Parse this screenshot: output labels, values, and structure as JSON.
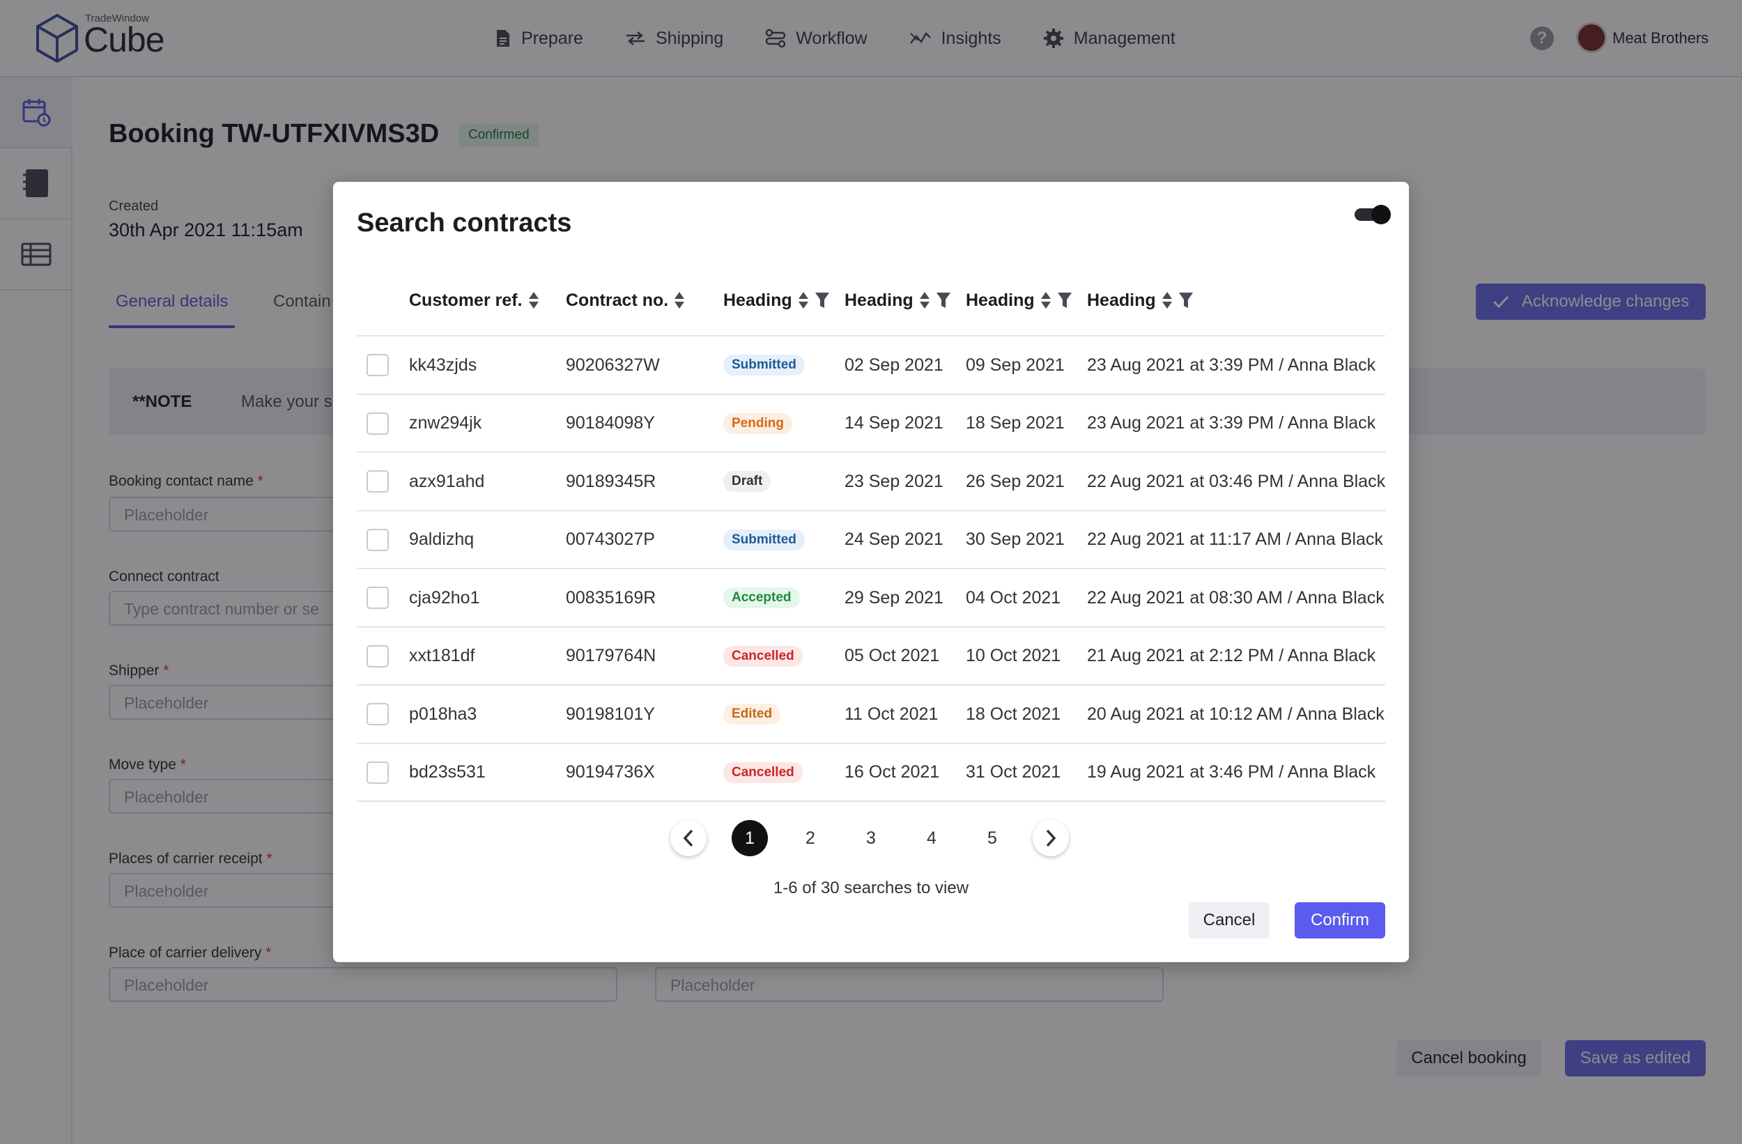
{
  "app": {
    "brand_small": "TradeWindow",
    "brand_name": "Cube",
    "nav": [
      {
        "label": "Prepare",
        "icon": "document-icon"
      },
      {
        "label": "Shipping",
        "icon": "swap-arrows-icon"
      },
      {
        "label": "Workflow",
        "icon": "workflow-icon"
      },
      {
        "label": "Insights",
        "icon": "trend-icon"
      },
      {
        "label": "Management",
        "icon": "gear-icon"
      }
    ],
    "account_name": "Meat Brothers"
  },
  "sidebar": {
    "items": [
      {
        "icon": "calendar-clock-icon",
        "active": true
      },
      {
        "icon": "notebook-icon",
        "active": false
      },
      {
        "icon": "table-list-icon",
        "active": false
      }
    ]
  },
  "page": {
    "title": "Booking TW-UTFXIVMS3D",
    "status": "Confirmed",
    "created_label": "Created",
    "created_value": "30th Apr 2021 11:15am",
    "tabs": [
      "General details",
      "Contain"
    ],
    "acknowledge_label": "Acknowledge changes",
    "note_label": "**NOTE",
    "note_text": "Make your select",
    "fields": {
      "booking_contact": {
        "label": "Booking contact name",
        "placeholder": "Placeholder"
      },
      "connect_contract": {
        "label": "Connect contract",
        "placeholder": "Type contract number or se"
      },
      "shipper": {
        "label": "Shipper",
        "placeholder": "Placeholder"
      },
      "move_type": {
        "label": "Move type",
        "placeholder": "Placeholder"
      },
      "carrier_receipt": {
        "label": "Places of carrier receipt",
        "placeholder": "Placeholder"
      },
      "carrier_delivery": {
        "label": "Place of carrier delivery",
        "placeholder": "Placeholder",
        "placeholder_right": "Placeholder"
      }
    },
    "required_mark": "*",
    "cancel_booking": "Cancel booking",
    "save_as_edited": "Save as edited"
  },
  "modal": {
    "title": "Search contracts",
    "columns": [
      "Customer ref.",
      "Contract no.",
      "Heading",
      "Heading",
      "Heading",
      "Heading"
    ],
    "rows": [
      {
        "ref": "kk43zjds",
        "contract": "90206327W",
        "status": "Submitted",
        "date1": "02 Sep 2021",
        "date2": "09 Sep 2021",
        "updated": "23 Aug 2021 at 3:39 PM / Anna Black"
      },
      {
        "ref": "znw294jk",
        "contract": "90184098Y",
        "status": "Pending",
        "date1": "14 Sep 2021",
        "date2": "18 Sep 2021",
        "updated": "23 Aug 2021 at 3:39 PM / Anna Black"
      },
      {
        "ref": "azx91ahd",
        "contract": "90189345R",
        "status": "Draft",
        "date1": "23 Sep 2021",
        "date2": "26 Sep 2021",
        "updated": "22 Aug 2021 at 03:46 PM / Anna Black"
      },
      {
        "ref": "9aldizhq",
        "contract": "00743027P",
        "status": "Submitted",
        "date1": "24 Sep 2021",
        "date2": "30 Sep 2021",
        "updated": "22 Aug 2021 at 11:17 AM / Anna Black"
      },
      {
        "ref": "cja92ho1",
        "contract": "00835169R",
        "status": "Accepted",
        "date1": "29 Sep 2021",
        "date2": "04 Oct 2021",
        "updated": "22 Aug 2021 at 08:30 AM / Anna Black"
      },
      {
        "ref": "xxt181df",
        "contract": "90179764N",
        "status": "Cancelled",
        "date1": "05 Oct 2021",
        "date2": "10 Oct 2021",
        "updated": "21 Aug 2021 at 2:12 PM / Anna Black"
      },
      {
        "ref": "p018ha3",
        "contract": "90198101Y",
        "status": "Edited",
        "date1": "11 Oct 2021",
        "date2": "18 Oct 2021",
        "updated": "20 Aug 2021 at 10:12 AM / Anna Black"
      },
      {
        "ref": "bd23s531",
        "contract": "90194736X",
        "status": "Cancelled",
        "date1": "16 Oct 2021",
        "date2": "31 Oct 2021",
        "updated": "19 Aug 2021 at 3:46 PM / Anna Black"
      }
    ],
    "status_colors": {
      "Submitted": {
        "bg": "#e6f0fb",
        "fg": "#1f5b94"
      },
      "Pending": {
        "bg": "#fdeee2",
        "fg": "#d46a12"
      },
      "Draft": {
        "bg": "#efeff2",
        "fg": "#333333"
      },
      "Accepted": {
        "bg": "#e5f6ea",
        "fg": "#1f8a42"
      },
      "Cancelled": {
        "bg": "#fde6e6",
        "fg": "#c62828"
      },
      "Edited": {
        "bg": "#fdf0e3",
        "fg": "#c26a14"
      }
    },
    "pagination": {
      "pages": [
        "1",
        "2",
        "3",
        "4",
        "5"
      ],
      "current": "1",
      "summary": "1-6 of 30 searches to view"
    },
    "cancel_label": "Cancel",
    "confirm_label": "Confirm"
  },
  "colors": {
    "accent": "#5b5bef",
    "overlay": "rgba(15,15,20,0.48)"
  }
}
